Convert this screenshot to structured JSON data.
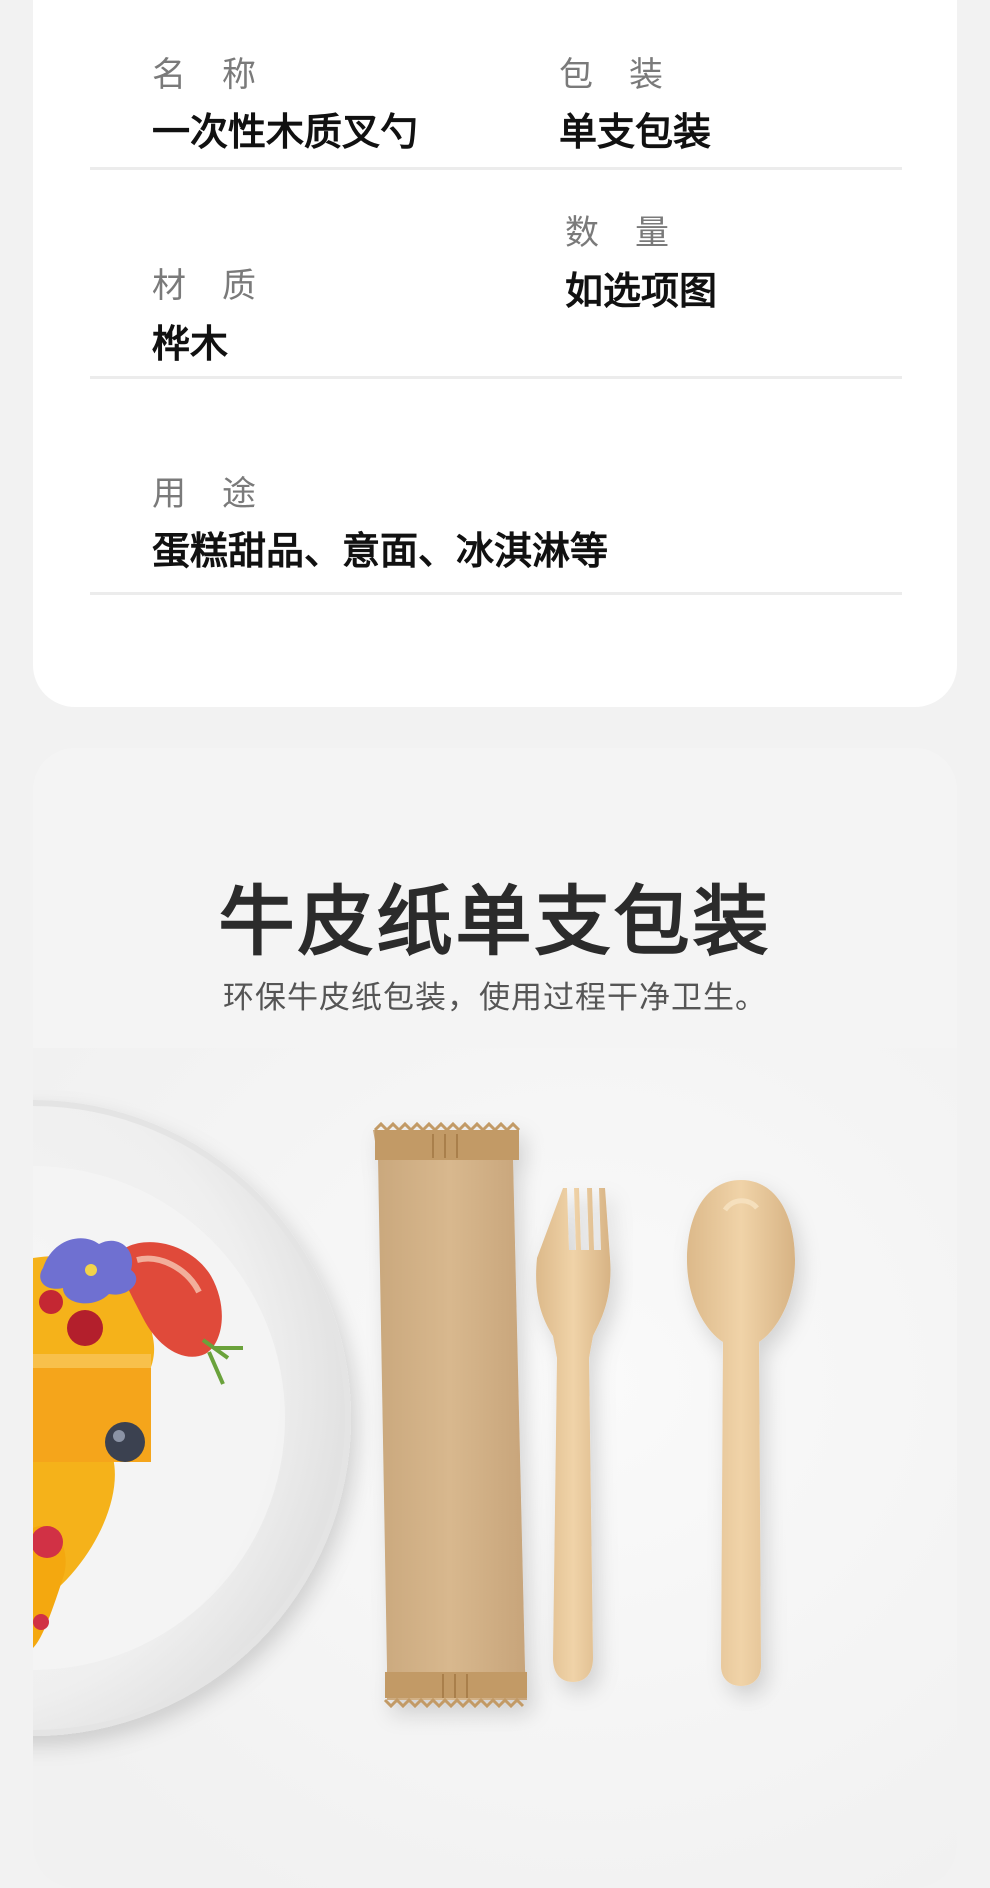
{
  "specs": {
    "name_label": "名称",
    "name_value": "一次性木质叉勺",
    "packaging_label": "包装",
    "packaging_value": "单支包装",
    "material_label": "材质",
    "material_value": "桦木",
    "quantity_label": "数量",
    "quantity_value": "如选项图",
    "usage_label": "用途",
    "usage_value": "蛋糕甜品、意面、冰淇淋等"
  },
  "packaging_section": {
    "title": "牛皮纸单支包装",
    "subtitle": "环保牛皮纸包装，使用过程干净卫生。"
  },
  "icons": [
    "dessert-plate-image",
    "kraft-paper-pouch-image",
    "wooden-fork-image",
    "wooden-spoon-image"
  ]
}
